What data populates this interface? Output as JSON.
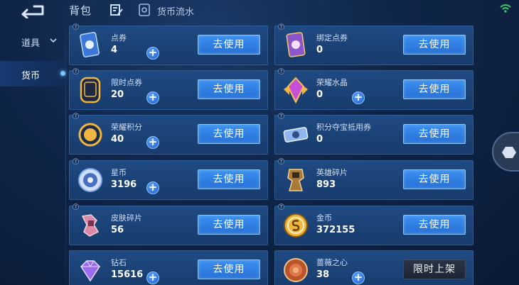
{
  "header": {
    "title": "背包",
    "flow_label": "货币流水"
  },
  "sidebar": {
    "items": [
      {
        "label": "道具"
      },
      {
        "label": "货币"
      }
    ]
  },
  "cards": [
    {
      "name": "点券",
      "value": "4",
      "button": "去使用"
    },
    {
      "name": "绑定点券",
      "value": "0",
      "button": "去使用"
    },
    {
      "name": "限时点券",
      "value": "20",
      "button": "去使用"
    },
    {
      "name": "荣耀水晶",
      "value": "0",
      "button": "去使用"
    },
    {
      "name": "荣耀积分",
      "value": "40",
      "button": "去使用"
    },
    {
      "name": "积分夺宝抵用券",
      "value": "0",
      "button": "去使用"
    },
    {
      "name": "星币",
      "value": "3196",
      "button": "去使用"
    },
    {
      "name": "英雄碎片",
      "value": "893",
      "button": "去使用"
    },
    {
      "name": "皮肤碎片",
      "value": "56",
      "button": "去使用"
    },
    {
      "name": "金币",
      "value": "372155",
      "button": "去使用"
    },
    {
      "name": "钻石",
      "value": "15616",
      "button": "去使用"
    },
    {
      "name": "蔷薇之心",
      "value": "38",
      "button": "限时上架"
    }
  ],
  "icons": {
    "ticket-icon": "card",
    "bound-ticket-icon": "card-purple",
    "limited-ticket-icon": "badge-limit",
    "crystal-icon": "crystal",
    "glory-points-icon": "coin-ji",
    "voucher-icon": "voucher",
    "star-coin-icon": "star",
    "hero-fragment-icon": "hero",
    "skin-fragment-icon": "skin",
    "gold-coin-icon": "gold",
    "diamond-icon": "gem",
    "rose-heart-icon": "rose"
  },
  "colors": {
    "button_blue": "#2f7fe6",
    "card_bg": "#1c4377",
    "accent_dark_button": "#222b3b"
  }
}
